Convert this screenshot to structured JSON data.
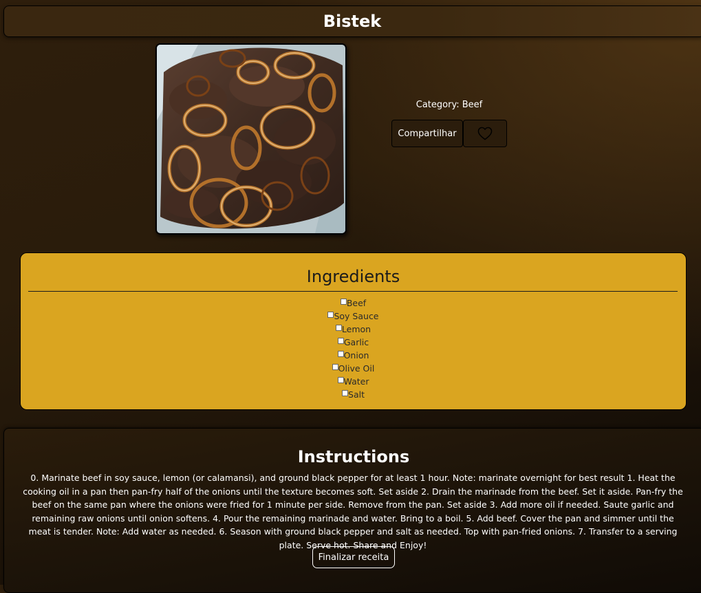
{
  "recipe": {
    "title": "Bistek",
    "category_text": "Category: Beef"
  },
  "actions": {
    "share_label": "Compartilhar",
    "favorite_icon": "heart-outline-icon"
  },
  "ingredients": {
    "heading": "Ingredients",
    "items": [
      {
        "label": "Beef",
        "checked": false
      },
      {
        "label": "Soy Sauce",
        "checked": false
      },
      {
        "label": "Lemon",
        "checked": false
      },
      {
        "label": "Garlic",
        "checked": false
      },
      {
        "label": "Onion",
        "checked": false
      },
      {
        "label": "Olive Oil",
        "checked": false
      },
      {
        "label": "Water",
        "checked": false
      },
      {
        "label": "Salt",
        "checked": false
      }
    ]
  },
  "instructions": {
    "heading": "Instructions",
    "text": "0. Marinate beef in soy sauce, lemon (or calamansi), and ground black pepper for at least 1 hour. Note: marinate overnight for best result 1. Heat the cooking oil in a pan then pan-fry half of the onions until the texture becomes soft. Set aside 2. Drain the marinade from the beef. Set it aside. Pan-fry the beef on the same pan where the onions were fried for 1 minute per side. Remove from the pan. Set aside 3. Add more oil if needed. Saute garlic and remaining raw onions until onion softens. 4. Pour the remaining marinade and water. Bring to a boil. 5. Add beef. Cover the pan and simmer until the meat is tender. Note: Add water as needed. 6. Season with ground black pepper and salt as needed. Top with pan-fried onions. 7. Transfer to a serving plate. Serve hot. Share and Enjoy!",
    "finish_label": "Finalizar receita"
  },
  "colors": {
    "ingredients_panel": "#daa520",
    "background_dark": "#1b1208",
    "text_light": "#ffffff"
  }
}
